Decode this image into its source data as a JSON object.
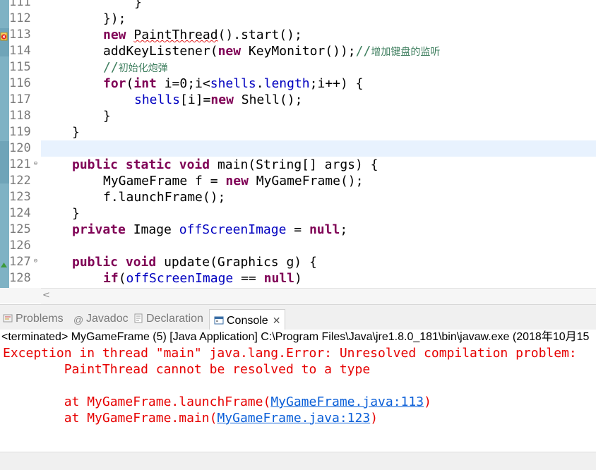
{
  "editor": {
    "lines": [
      {
        "num": "111",
        "marker": "",
        "fold": false,
        "current": false
      },
      {
        "num": "112",
        "marker": "",
        "fold": false,
        "current": false
      },
      {
        "num": "113",
        "marker": "error",
        "fold": false,
        "current": false
      },
      {
        "num": "114",
        "marker": "",
        "fold": false,
        "current": false
      },
      {
        "num": "115",
        "marker": "",
        "fold": false,
        "current": false
      },
      {
        "num": "116",
        "marker": "",
        "fold": false,
        "current": false
      },
      {
        "num": "117",
        "marker": "",
        "fold": false,
        "current": false
      },
      {
        "num": "118",
        "marker": "",
        "fold": false,
        "current": false
      },
      {
        "num": "119",
        "marker": "",
        "fold": false,
        "current": false
      },
      {
        "num": "120",
        "marker": "",
        "fold": false,
        "current": true
      },
      {
        "num": "121",
        "marker": "",
        "fold": true,
        "current": false
      },
      {
        "num": "122",
        "marker": "",
        "fold": false,
        "current": false
      },
      {
        "num": "123",
        "marker": "",
        "fold": false,
        "current": false
      },
      {
        "num": "124",
        "marker": "",
        "fold": false,
        "current": false
      },
      {
        "num": "125",
        "marker": "",
        "fold": false,
        "current": false
      },
      {
        "num": "126",
        "marker": "",
        "fold": false,
        "current": false
      },
      {
        "num": "127",
        "marker": "override",
        "fold": true,
        "current": false
      },
      {
        "num": "128",
        "marker": "",
        "fold": false,
        "current": false
      }
    ],
    "code": {
      "l111": "}",
      "l112": "});",
      "l113_kw": "new",
      "l113_class": "PaintThread",
      "l113_rest": "().start();",
      "l114_a": "addKeyListener(",
      "l114_kw": "new",
      "l114_b": " KeyMonitor());",
      "l114_cmt": "//",
      "l114_cjk": "增加键盘的监听",
      "l115_cmt": "//",
      "l115_cjk": "初始化炮弹",
      "l116_kw1": "for",
      "l116_a": "(",
      "l116_kw2": "int",
      "l116_b": " i=0;i<",
      "l116_f1": "shells",
      "l116_c": ".",
      "l116_f2": "length",
      "l116_d": ";i++) {",
      "l117_f": "shells",
      "l117_a": "[i]=",
      "l117_kw": "new",
      "l117_b": " Shell();",
      "l118": "}",
      "l119": "}",
      "l121_kw1": "public",
      "l121_kw2": "static",
      "l121_kw3": "void",
      "l121_rest": " main(String[] args) {",
      "l122_a": "MyGameFrame f = ",
      "l122_kw": "new",
      "l122_b": " MyGameFrame();",
      "l123": "f.launchFrame();",
      "l124": "}",
      "l125_kw1": "private",
      "l125_a": " Image ",
      "l125_f": "offScreenImage",
      "l125_b": " = ",
      "l125_kw2": "null",
      "l125_c": ";",
      "l127_kw1": "public",
      "l127_kw2": "void",
      "l127_rest": " update(Graphics g) {",
      "l128_kw": "if",
      "l128_a": "(",
      "l128_f": "offScreenImage",
      "l128_b": " == ",
      "l128_kw2": "null",
      "l128_c": ")"
    }
  },
  "tabs": [
    {
      "label": "Problems",
      "icon": "problems-icon",
      "active": false
    },
    {
      "label": "Javadoc",
      "icon": "javadoc-icon",
      "active": false
    },
    {
      "label": "Declaration",
      "icon": "declaration-icon",
      "active": false
    },
    {
      "label": "Console",
      "icon": "console-icon",
      "active": true
    }
  ],
  "console": {
    "status": "<terminated> MyGameFrame (5) [Java Application] C:\\Program Files\\Java\\jre1.8.0_181\\bin\\javaw.exe (2018年10月15",
    "line1": "Exception in thread \"main\" java.lang.Error: Unresolved compilation problem:",
    "line2": "\tPaintThread cannot be resolved to a type",
    "line3_a": "\tat MyGameFrame.launchFrame(",
    "line3_link": "MyGameFrame.java:113",
    "line3_b": ")",
    "line4_a": "\tat MyGameFrame.main(",
    "line4_link": "MyGameFrame.java:123",
    "line4_b": ")"
  },
  "colors": {
    "keyword": "#7f0055",
    "field": "#0000c0",
    "comment": "#3f7f5f",
    "error": "#e60000",
    "link": "#0b5fd8",
    "current_line": "#e8f2fe"
  }
}
